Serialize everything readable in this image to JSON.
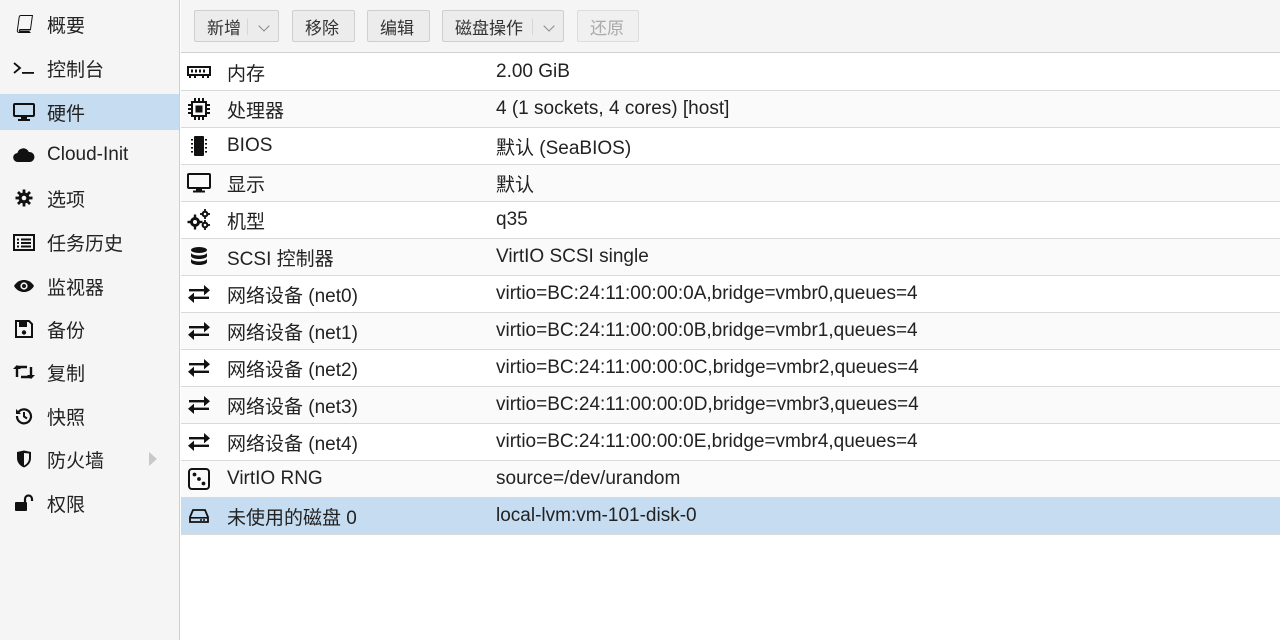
{
  "sidebar": {
    "items": [
      {
        "label": "概要",
        "icon": "book-icon"
      },
      {
        "label": "控制台",
        "icon": "terminal-icon"
      },
      {
        "label": "硬件",
        "icon": "desktop-icon",
        "active": true
      },
      {
        "label": "Cloud-Init",
        "icon": "cloud-icon"
      },
      {
        "label": "选项",
        "icon": "gear-icon"
      },
      {
        "label": "任务历史",
        "icon": "list-icon"
      },
      {
        "label": "监视器",
        "icon": "eye-icon"
      },
      {
        "label": "备份",
        "icon": "floppy-icon"
      },
      {
        "label": "复制",
        "icon": "retweet-icon"
      },
      {
        "label": "快照",
        "icon": "history-icon"
      },
      {
        "label": "防火墙",
        "icon": "shield-icon",
        "expandable": true
      },
      {
        "label": "权限",
        "icon": "unlock-icon"
      }
    ]
  },
  "toolbar": {
    "add_label": "新增",
    "remove_label": "移除",
    "edit_label": "编辑",
    "disk_action_label": "磁盘操作",
    "revert_label": "还原"
  },
  "hardware": {
    "rows": [
      {
        "name": "内存",
        "value": "2.00 GiB",
        "icon": "memory-icon"
      },
      {
        "name": "处理器",
        "value": "4 (1 sockets, 4 cores) [host]",
        "icon": "cpu-icon"
      },
      {
        "name": "BIOS",
        "value": "默认 (SeaBIOS)",
        "icon": "microchip-icon"
      },
      {
        "name": "显示",
        "value": "默认",
        "icon": "monitor-icon"
      },
      {
        "name": "机型",
        "value": "q35",
        "icon": "cogs-icon"
      },
      {
        "name": "SCSI 控制器",
        "value": "VirtIO SCSI single",
        "icon": "database-icon"
      },
      {
        "name": "网络设备 (net0)",
        "value": "virtio=BC:24:11:00:00:0A,bridge=vmbr0,queues=4",
        "icon": "exchange-icon"
      },
      {
        "name": "网络设备 (net1)",
        "value": "virtio=BC:24:11:00:00:0B,bridge=vmbr1,queues=4",
        "icon": "exchange-icon"
      },
      {
        "name": "网络设备 (net2)",
        "value": "virtio=BC:24:11:00:00:0C,bridge=vmbr2,queues=4",
        "icon": "exchange-icon"
      },
      {
        "name": "网络设备 (net3)",
        "value": "virtio=BC:24:11:00:00:0D,bridge=vmbr3,queues=4",
        "icon": "exchange-icon"
      },
      {
        "name": "网络设备 (net4)",
        "value": "virtio=BC:24:11:00:00:0E,bridge=vmbr4,queues=4",
        "icon": "exchange-icon"
      },
      {
        "name": "VirtIO RNG",
        "value": "source=/dev/urandom",
        "icon": "dice-icon"
      },
      {
        "name": "未使用的磁盘 0",
        "value": "local-lvm:vm-101-disk-0",
        "icon": "hdd-icon",
        "selected": true
      }
    ]
  },
  "colors": {
    "selection": "#c5dcf1",
    "sidebar_bg": "#f5f5f5"
  }
}
